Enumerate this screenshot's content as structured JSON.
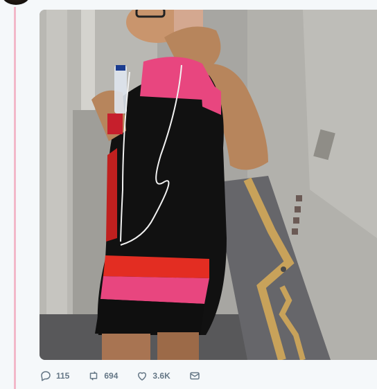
{
  "tweet": {
    "actions": {
      "reply_count": "115",
      "retweet_count": "694",
      "like_count": "3.6K"
    }
  },
  "icons": {
    "reply": "reply-icon",
    "retweet": "retweet-icon",
    "like": "like-icon",
    "direct_message": "direct-message-icon"
  },
  "colors": {
    "thread_line": "#f2b8c9",
    "action_icon": "#657786",
    "background": "#f5f8fa"
  }
}
